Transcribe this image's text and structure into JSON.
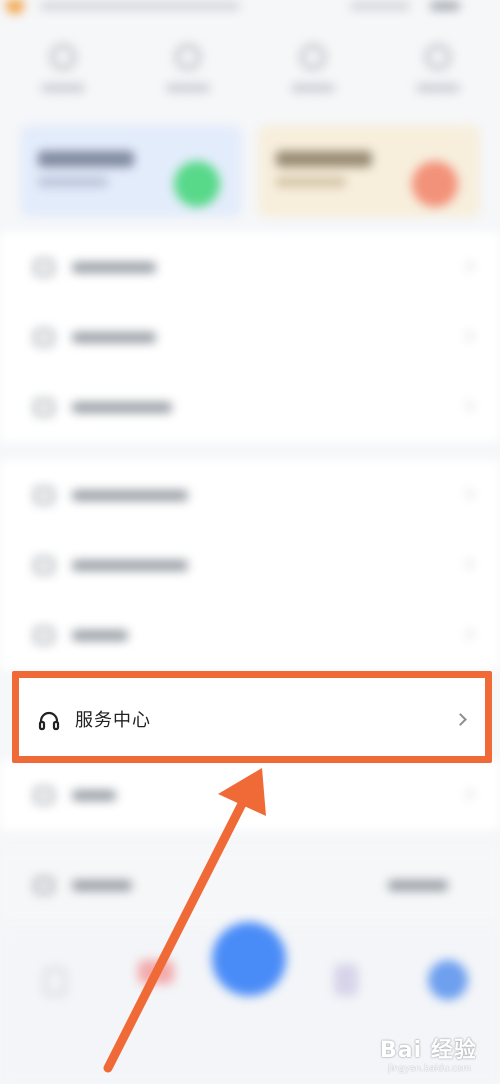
{
  "menu": {
    "service_center": {
      "label": "服务中心",
      "icon": "headset-icon"
    }
  },
  "watermark": {
    "brand": "Bai 经验",
    "url": "jingyan.baidu.com"
  },
  "colors": {
    "highlight_border": "#f06a37",
    "arrow": "#f06a37",
    "center_button": "#4a8cf7"
  }
}
